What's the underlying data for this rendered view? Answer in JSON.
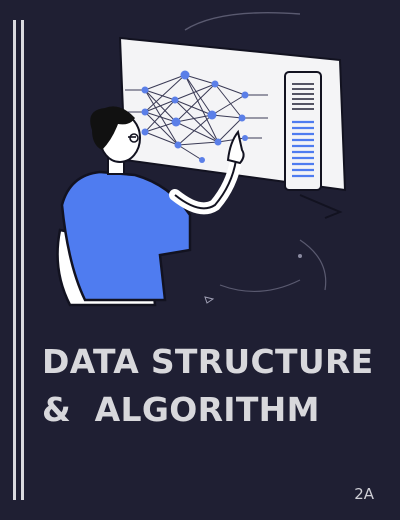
{
  "cover": {
    "title_line1": "DATA STRUCTURE",
    "title_line2": "&  ALGORITHM",
    "tag": "2A"
  },
  "illustration": {
    "subject": "person-touching-neural-network-screen",
    "colors": {
      "background": "#1f1f33",
      "screen": "#f5f5f7",
      "accent_blue": "#4f7cf0",
      "node_blue": "#5b7fe8",
      "skin": "#ffffff",
      "hair": "#111111"
    }
  }
}
